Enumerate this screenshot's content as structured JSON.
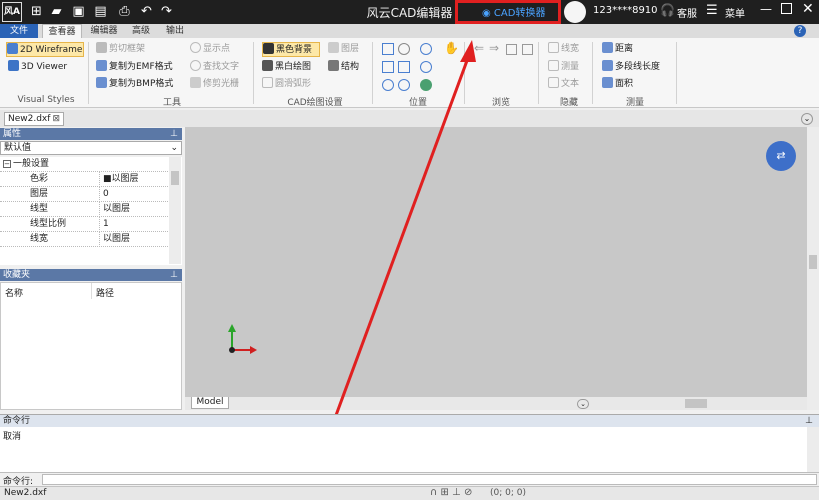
{
  "window": {
    "title": "风云CAD编辑器"
  },
  "quick_access": [
    {
      "name": "new-file-icon",
      "glyph": "⊞"
    },
    {
      "name": "open-folder-icon",
      "glyph": "▰"
    },
    {
      "name": "save-icon",
      "glyph": "▣"
    },
    {
      "name": "save-all-icon",
      "glyph": "▤"
    },
    {
      "name": "print-icon",
      "glyph": "⎙"
    },
    {
      "name": "undo-icon",
      "glyph": "↶"
    },
    {
      "name": "redo-icon",
      "glyph": "↷"
    }
  ],
  "logo_text": "风A",
  "converter_label": "CAD转换器",
  "user": {
    "id": "123****8910",
    "service": "客服",
    "menu": "菜单"
  },
  "menu_tabs": [
    "文件",
    "查看器",
    "编辑器",
    "高级",
    "输出"
  ],
  "ribbon": {
    "visual_styles": {
      "items": [
        "2D Wireframe",
        "3D Viewer"
      ],
      "group": "Visual Styles"
    },
    "tools": {
      "items": [
        "剪切框架",
        "复制为EMF格式",
        "复制为BMP格式",
        "显示点",
        "查找文字",
        "修剪光栅"
      ],
      "group": "工具"
    },
    "cad_settings": {
      "items": [
        "黑色背景",
        "黑白绘图",
        "圆滑弧形",
        "图层",
        "结构"
      ],
      "group": "CAD绘图设置"
    },
    "position": {
      "group": "位置"
    },
    "browse": {
      "group": "浏览"
    },
    "hide": {
      "items": [
        "线宽",
        "测量",
        "文本"
      ],
      "group": "隐藏"
    },
    "measure": {
      "items": [
        "距离",
        "多段线长度",
        "面积"
      ],
      "group": "测量"
    }
  },
  "doc_tab": "New2.dxf",
  "properties": {
    "header": "属性",
    "dropdown": "默认值",
    "section": "一般设置",
    "rows": [
      {
        "k": "色彩",
        "v": "■以图层"
      },
      {
        "k": "图层",
        "v": "0"
      },
      {
        "k": "线型",
        "v": "以图层"
      },
      {
        "k": "线型比例",
        "v": "1"
      },
      {
        "k": "线宽",
        "v": "以图层"
      }
    ]
  },
  "favorites": {
    "header": "收藏夹",
    "col_name": "名称",
    "col_path": "路径"
  },
  "model_tab": "Model",
  "command": {
    "header": "命令行",
    "output": "取消",
    "prompt": "命令行:"
  },
  "status": {
    "file": "New2.dxf",
    "coords": "(0; 0; 0)"
  },
  "colors": {
    "annotation_red": "#e02020",
    "accent_blue": "#2b63b6",
    "canvas": "#c8c8c8"
  }
}
